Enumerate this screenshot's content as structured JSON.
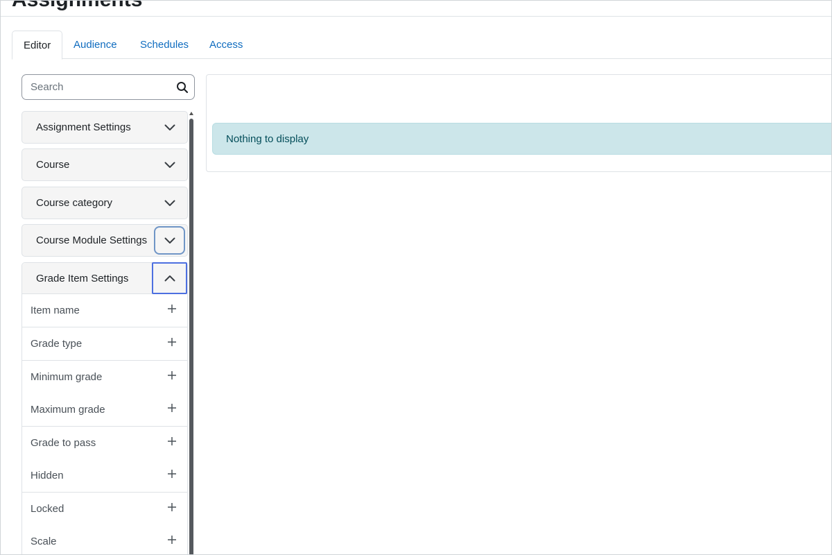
{
  "page": {
    "title": "Assignments"
  },
  "tabs": [
    {
      "label": "Editor",
      "active": true
    },
    {
      "label": "Audience",
      "active": false
    },
    {
      "label": "Schedules",
      "active": false
    },
    {
      "label": "Access",
      "active": false
    }
  ],
  "search": {
    "placeholder": "Search",
    "value": "",
    "icon": "search-icon"
  },
  "sidebar": {
    "sections": [
      {
        "label": "Assignment Settings",
        "expanded": false,
        "icon": "chevron-down-icon"
      },
      {
        "label": "Course",
        "expanded": false,
        "icon": "chevron-down-icon"
      },
      {
        "label": "Course category",
        "expanded": false,
        "icon": "chevron-down-icon"
      },
      {
        "label": "Course Module Settings",
        "expanded": false,
        "icon": "chevron-down-icon"
      },
      {
        "label": "Grade Item Settings",
        "expanded": true,
        "icon": "chevron-up-icon"
      }
    ],
    "grade_item_fields": [
      {
        "label": "Item name",
        "icon": "plus-icon"
      },
      {
        "label": "Grade type",
        "icon": "plus-icon"
      },
      {
        "label": "Minimum grade",
        "icon": "plus-icon"
      },
      {
        "label": "Maximum grade",
        "icon": "plus-icon"
      },
      {
        "label": "Grade to pass",
        "icon": "plus-icon"
      },
      {
        "label": "Hidden",
        "icon": "plus-icon"
      },
      {
        "label": "Locked",
        "icon": "plus-icon"
      },
      {
        "label": "Scale",
        "icon": "plus-icon"
      }
    ]
  },
  "main": {
    "empty_message": "Nothing to display"
  },
  "colors": {
    "link": "#0f6cbf",
    "text": "#1d2125",
    "alert_bg": "#cce6ea",
    "alert_text": "#044e5a",
    "focus_ring": "#4c6fe0"
  }
}
